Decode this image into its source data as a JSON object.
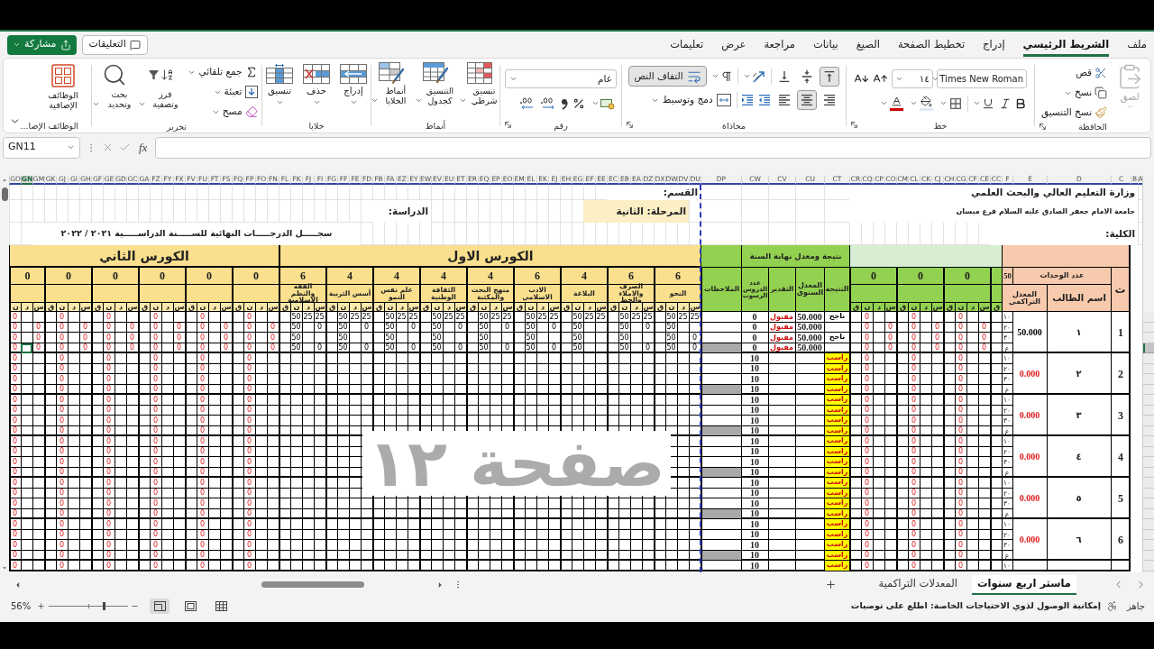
{
  "ribbon_tabs": [
    {
      "label": "ملف",
      "selected": false
    },
    {
      "label": "الشريط الرئيسي",
      "selected": true
    },
    {
      "label": "إدراج",
      "selected": false
    },
    {
      "label": "تخطيط الصفحة",
      "selected": false
    },
    {
      "label": "الصيغ",
      "selected": false
    },
    {
      "label": "بيانات",
      "selected": false
    },
    {
      "label": "مراجعة",
      "selected": false
    },
    {
      "label": "عرض",
      "selected": false
    },
    {
      "label": "تعليمات",
      "selected": false
    }
  ],
  "header_buttons": {
    "comments": "التعليقات",
    "share": "مشاركة"
  },
  "ribbon_groups": [
    {
      "kind": "clipboard",
      "label": "الحافظة",
      "paste": {
        "label": "لصق",
        "disabled": true
      },
      "cut": "قص",
      "copy": "نسخ",
      "format_painter": "نسخ التنسيق"
    },
    {
      "kind": "font",
      "label": "خط",
      "font_name": "Times New Roman",
      "font_size": "١٤"
    },
    {
      "kind": "alignment",
      "label": "محاذاة",
      "vertical": [
        {
          "selected": true
        },
        {
          "selected": false
        },
        {
          "selected": false
        }
      ],
      "wrap_text": {
        "label": "التفاف النص",
        "on": true
      },
      "horizontal": [
        {
          "selected": false
        },
        {
          "selected": true
        },
        {
          "selected": false
        }
      ],
      "merge": "دمج وتوسيط"
    },
    {
      "kind": "number",
      "label": "رقم",
      "format": "عام"
    },
    {
      "kind": "styles",
      "label": "أنماط",
      "buttons": [
        "تنسيق شرطي",
        "التنسيق كجدول",
        "أنماط الخلايا"
      ]
    },
    {
      "kind": "cells",
      "label": "خلايا",
      "buttons": [
        "إدراج",
        "حذف",
        "تنسيق"
      ]
    },
    {
      "kind": "editing",
      "label": "تحرير",
      "small_buttons": [
        "جمع تلقائي",
        "تعبئة",
        "مسح"
      ],
      "buttons": [
        "فرز وتصفية",
        "بحث وتحديد"
      ]
    },
    {
      "kind": "addins",
      "label": "الوظائف الإضا...",
      "button": "الوظائف الإضافية"
    }
  ],
  "formula_bar": {
    "name_box": "GN11",
    "function_button": "fx"
  },
  "sheet": {
    "columns": [
      {
        "label": "A",
        "selected": false
      },
      {
        "label": "B",
        "selected": false
      },
      {
        "label": "C",
        "selected": false
      },
      {
        "label": "D",
        "selected": false
      },
      {
        "label": "E",
        "selected": false
      },
      {
        "label": "F",
        "selected": false
      },
      {
        "label": "CC",
        "selected": false
      },
      {
        "label": "CE",
        "selected": false
      },
      {
        "label": "CF",
        "selected": false
      },
      {
        "label": "CG",
        "selected": false
      },
      {
        "label": "CH",
        "selected": false
      },
      {
        "label": "CJ",
        "selected": false
      },
      {
        "label": "CK",
        "selected": false
      },
      {
        "label": "CL",
        "selected": false
      },
      {
        "label": "CM",
        "selected": false
      },
      {
        "label": "CO",
        "selected": false
      },
      {
        "label": "CP",
        "selected": false
      },
      {
        "label": "CQ",
        "selected": false
      },
      {
        "label": "CR",
        "selected": false
      },
      {
        "label": "CT",
        "selected": false
      },
      {
        "label": "CU",
        "selected": false
      },
      {
        "label": "CV",
        "selected": false
      },
      {
        "label": "CW",
        "selected": false
      },
      {
        "label": "DP",
        "selected": false
      },
      {
        "label": "DU",
        "selected": false
      },
      {
        "label": "DV",
        "selected": false
      },
      {
        "label": "DW",
        "selected": false
      },
      {
        "label": "DX",
        "selected": false
      },
      {
        "label": "DZ",
        "selected": false
      },
      {
        "label": "EA",
        "selected": false
      },
      {
        "label": "EB",
        "selected": false
      },
      {
        "label": "EC",
        "selected": false
      },
      {
        "label": "EE",
        "selected": false
      },
      {
        "label": "EF",
        "selected": false
      },
      {
        "label": "EG",
        "selected": false
      },
      {
        "label": "EH",
        "selected": false
      },
      {
        "label": "EJ",
        "selected": false
      },
      {
        "label": "EK",
        "selected": false
      },
      {
        "label": "EL",
        "selected": false
      },
      {
        "label": "EM",
        "selected": false
      },
      {
        "label": "EO",
        "selected": false
      },
      {
        "label": "EP",
        "selected": false
      },
      {
        "label": "EQ",
        "selected": false
      },
      {
        "label": "ER",
        "selected": false
      },
      {
        "label": "ET",
        "selected": false
      },
      {
        "label": "EU",
        "selected": false
      },
      {
        "label": "EV",
        "selected": false
      },
      {
        "label": "EW",
        "selected": false
      },
      {
        "label": "EY",
        "selected": false
      },
      {
        "label": "EZ",
        "selected": false
      },
      {
        "label": "FA",
        "selected": false
      },
      {
        "label": "FB",
        "selected": false
      },
      {
        "label": "FD",
        "selected": false
      },
      {
        "label": "FE",
        "selected": false
      },
      {
        "label": "FF",
        "selected": false
      },
      {
        "label": "FG",
        "selected": false
      },
      {
        "label": "FI",
        "selected": false
      },
      {
        "label": "FJ",
        "selected": false
      },
      {
        "label": "FK",
        "selected": false
      },
      {
        "label": "FL",
        "selected": false
      },
      {
        "label": "FN",
        "selected": false
      },
      {
        "label": "FO",
        "selected": false
      },
      {
        "label": "FP",
        "selected": false
      },
      {
        "label": "FQ",
        "selected": false
      },
      {
        "label": "FS",
        "selected": false
      },
      {
        "label": "FT",
        "selected": false
      },
      {
        "label": "FU",
        "selected": false
      },
      {
        "label": "FV",
        "selected": false
      },
      {
        "label": "FX",
        "selected": false
      },
      {
        "label": "FY",
        "selected": false
      },
      {
        "label": "FZ",
        "selected": false
      },
      {
        "label": "GA",
        "selected": false
      },
      {
        "label": "GC",
        "selected": false
      },
      {
        "label": "GD",
        "selected": false
      },
      {
        "label": "GE",
        "selected": false
      },
      {
        "label": "GF",
        "selected": false
      },
      {
        "label": "GH",
        "selected": false
      },
      {
        "label": "GI",
        "selected": false
      },
      {
        "label": "GJ",
        "selected": false
      },
      {
        "label": "GK",
        "selected": false
      },
      {
        "label": "GM",
        "selected": false
      },
      {
        "label": "GN",
        "selected": true
      },
      {
        "label": "GO",
        "selected": false
      }
    ],
    "title_rows": {
      "ministry": "وزارة التعليم العالي والبحث العلمي",
      "department": "القسم:",
      "university": "جامعة الامام جعفر الصادق عليه السلام فرع ميسان",
      "stage": "المرحلة: الثانية",
      "study": "الدراسة:",
      "college": "الكلية:",
      "record_title": "سجـــــل الدرجـــــات النهائية للســـــنة الدراســـــية ٢٠٢١ / ٢٠٢٢"
    },
    "headers": {
      "number": "ت",
      "units_label": "عدد الوحدات",
      "units_total": "50",
      "student_name": "اسم الطالب",
      "cumulative": "المعدل التراكمي",
      "year_result_title": "نتيجة ومعدل نهاية السنة",
      "result": "النتيجة",
      "annual_average": "المعدل السنوي",
      "grade": "التقدير",
      "failed_subjects": "عدد الدروس الرسوب",
      "notes": "الملاحظات"
    },
    "extra_column": "ق",
    "extra_subjects": [
      {
        "units": "0",
        "columns": [
          "س",
          "د",
          "ن",
          "ق"
        ]
      },
      {
        "units": "0",
        "columns": [
          "س",
          "د",
          "ن",
          "ق"
        ]
      },
      {
        "units": "0",
        "columns": [
          "س",
          "د",
          "ن",
          "ق"
        ]
      }
    ],
    "first_course": {
      "title": "الكورس الاول",
      "subjects": [
        {
          "units": "6",
          "name": "النحو",
          "columns": [
            "س",
            "د",
            "ن",
            "ق"
          ]
        },
        {
          "units": "6",
          "name": "الصرف والاملاء والخط",
          "columns": [
            "س",
            "د",
            "ن",
            "ق"
          ]
        },
        {
          "units": "4",
          "name": "البلاغة",
          "columns": [
            "س",
            "د",
            "ن",
            "ق"
          ]
        },
        {
          "units": "6",
          "name": "الادب الاسلامي",
          "columns": [
            "س",
            "د",
            "ن",
            "ق"
          ]
        },
        {
          "units": "4",
          "name": "منهج البحث والمكتبة",
          "columns": [
            "س",
            "د",
            "ن",
            "ق"
          ]
        },
        {
          "units": "4",
          "name": "الثقافة الوطنية",
          "columns": [
            "س",
            "د",
            "ن",
            "ق"
          ]
        },
        {
          "units": "4",
          "name": "علم نفس النمو",
          "columns": [
            "س",
            "د",
            "ن",
            "ق"
          ]
        },
        {
          "units": "4",
          "name": "أسس التربية",
          "columns": [
            "س",
            "د",
            "ن",
            "ق"
          ]
        },
        {
          "units": "6",
          "name": "الفقه والنظم الاسلامية",
          "columns": [
            "س",
            "د",
            "ن",
            "ق"
          ]
        }
      ]
    },
    "second_course": {
      "title": "الكورس الثاني",
      "subjects": [
        {
          "units": "0",
          "columns": [
            "س",
            "د",
            "ن",
            "ق"
          ]
        },
        {
          "units": "0",
          "columns": [
            "س",
            "د",
            "ن",
            "ق"
          ]
        },
        {
          "units": "0",
          "columns": [
            "س",
            "د",
            "ن",
            "ق"
          ]
        },
        {
          "units": "0",
          "columns": [
            "س",
            "د",
            "ن",
            "ق"
          ]
        },
        {
          "units": "0",
          "columns": [
            "س",
            "د",
            "ن",
            "ق"
          ]
        },
        {
          "units": "0",
          "columns": [
            "س",
            "د",
            "ن"
          ]
        }
      ]
    },
    "students": [
      {
        "number": "1",
        "name": "١",
        "cumulative": "50.000",
        "failed": false,
        "rows": [
          {
            "label": "١٠",
            "extra": [
              {
                "column_3": "0"
              },
              {
                "column_3": "0"
              },
              {
                "column_3": "0"
              }
            ],
            "result": "ناجح",
            "annual": "50.000",
            "grade": "مقبول",
            "failed_subjects": "0",
            "first_course": [
              {
                "column_1": "25",
                "column_2": "25",
                "column_3": "50"
              },
              {
                "column_1": "25",
                "column_2": "25",
                "column_3": "50"
              },
              {
                "column_1": "25",
                "column_2": "25",
                "column_3": "50"
              },
              {
                "column_1": "25",
                "column_2": "25",
                "column_3": "50"
              },
              {
                "column_1": "25",
                "column_2": "25",
                "column_3": "50"
              },
              {
                "column_1": "25",
                "column_2": "25",
                "column_3": "50"
              },
              {
                "column_1": "25",
                "column_2": "25",
                "column_3": "50"
              },
              {
                "column_1": "25",
                "column_2": "25",
                "column_3": "50"
              },
              {
                "column_1": "25",
                "column_2": "25",
                "column_3": "50"
              }
            ],
            "second_course": [
              {
                "column_3": "0"
              },
              {
                "column_3": "0"
              },
              {
                "column_3": "0"
              },
              {
                "column_3": "0"
              },
              {
                "column_3": "0"
              },
              {
                "column_3": "0"
              }
            ],
            "selected": false
          },
          {
            "label": "٢٠",
            "extra": [
              {
                "column_1": "0",
                "column_3": "0"
              },
              {
                "column_1": "0",
                "column_3": "0"
              },
              {
                "column_1": "0",
                "column_3": "0"
              }
            ],
            "annual": "50.000",
            "grade": "مقبول",
            "failed_subjects": "0",
            "first_course": [
              {
                "column_3": "50"
              },
              {
                "column_1": "0",
                "column_3": "50"
              },
              {
                "column_3": "50"
              },
              {
                "column_1": "0",
                "column_3": "50"
              },
              {
                "column_1": "0",
                "column_3": "50"
              },
              {
                "column_1": "0",
                "column_3": "50"
              },
              {
                "column_1": "0",
                "column_3": "50"
              },
              {
                "column_1": "0",
                "column_3": "50"
              },
              {
                "column_1": "0",
                "column_3": "50"
              }
            ],
            "second_course": [
              {
                "column_1": "0",
                "column_3": "0"
              },
              {
                "column_1": "0",
                "column_3": "0"
              },
              {
                "column_1": "0",
                "column_3": "0"
              },
              {
                "column_1": "0",
                "column_3": "0"
              },
              {
                "column_1": "0",
                "column_3": "0"
              },
              {
                "column_1": "0",
                "column_3": "0"
              }
            ],
            "selected": false
          },
          {
            "label": "٣٠",
            "extra": [
              {
                "column_1": "0",
                "column_3": "0"
              },
              {
                "column_1": "0",
                "column_3": "0"
              },
              {
                "column_1": "0",
                "column_3": "0"
              }
            ],
            "result": "ناجح",
            "annual": "50.000",
            "grade": "مقبول",
            "failed_subjects": "0",
            "first_course": [
              {
                "column_1": "0",
                "column_3": "50"
              },
              {
                "column_3": "50"
              },
              {
                "column_3": "50"
              },
              {
                "column_3": "50"
              },
              {
                "column_3": "50"
              },
              {
                "column_3": "50"
              },
              {
                "column_3": "50"
              },
              {
                "column_3": "50"
              },
              {
                "column_3": "50"
              }
            ],
            "second_course": [
              {
                "column_1": "0",
                "column_3": "0"
              },
              {
                "column_1": "0",
                "column_3": "0"
              },
              {
                "column_1": "0",
                "column_3": "0"
              },
              {
                "column_1": "0",
                "column_3": "0"
              },
              {
                "column_1": "0",
                "column_3": "0"
              },
              {
                "column_1": "0",
                "column_3": "0"
              }
            ],
            "selected": false
          },
          {
            "label": "ع",
            "extra": [
              {
                "column_1": "0",
                "column_3": "0"
              },
              {
                "column_1": "0",
                "column_3": "0"
              },
              {
                "column_1": "0",
                "column_3": "0"
              }
            ],
            "annual": "50.000",
            "grade": "مقبول",
            "failed_subjects": "0",
            "shaded": true,
            "first_course": [
              {
                "column_1": "0",
                "column_3": "50"
              },
              {
                "column_1": "0",
                "column_3": "50"
              },
              {
                "column_3": "50"
              },
              {
                "column_1": "0",
                "column_3": "50"
              },
              {
                "column_1": "0",
                "column_3": "50"
              },
              {
                "column_1": "0",
                "column_3": "50"
              },
              {
                "column_1": "0",
                "column_3": "50"
              },
              {
                "column_1": "0",
                "column_3": "50"
              },
              {
                "column_1": "0",
                "column_3": "50"
              }
            ],
            "second_course": [
              {
                "column_1": "0",
                "column_3": "0"
              },
              {
                "column_1": "0",
                "column_3": "0"
              },
              {
                "column_1": "0",
                "column_3": "0"
              },
              {
                "column_1": "0",
                "column_3": "0"
              },
              {
                "column_1": "0",
                "column_3": "0"
              },
              {
                "column_1": "0",
                "column_3": "0"
              }
            ],
            "selected": true
          }
        ]
      },
      {
        "number": "2",
        "name": "٢",
        "cumulative": "0.000",
        "failed": true,
        "rows": [
          {
            "label": "١٠",
            "extra": [
              {
                "column_3": "0"
              },
              {
                "column_3": "0"
              },
              {
                "column_3": "0"
              }
            ],
            "result": "راسب",
            "failed_subjects": "10",
            "second_course": [
              {
                "column_3": "0"
              },
              {
                "column_3": "0"
              },
              {
                "column_3": "0"
              },
              {
                "column_3": "0"
              },
              {
                "column_3": "0"
              },
              {
                "column_3": "0"
              }
            ],
            "selected": false
          },
          {
            "label": "٢٠",
            "extra": [
              {
                "column_3": "0"
              },
              {
                "column_3": "0"
              },
              {
                "column_3": "0"
              }
            ],
            "result": "راسب",
            "failed_subjects": "10",
            "second_course": [
              {
                "column_3": "0"
              },
              {
                "column_3": "0"
              },
              {
                "column_3": "0"
              },
              {
                "column_3": "0"
              },
              {
                "column_3": "0"
              },
              {
                "column_3": "0"
              }
            ],
            "selected": false
          },
          {
            "label": "٣٠",
            "extra": [
              {
                "column_3": "0"
              },
              {
                "column_3": "0"
              },
              {
                "column_3": "0"
              }
            ],
            "result": "راسب",
            "failed_subjects": "10",
            "second_course": [
              {
                "column_3": "0"
              },
              {
                "column_3": "0"
              },
              {
                "column_3": "0"
              },
              {
                "column_3": "0"
              },
              {
                "column_3": "0"
              },
              {
                "column_3": "0"
              }
            ],
            "selected": false
          },
          {
            "label": "ع",
            "extra": [
              {
                "column_3": "0"
              },
              {
                "column_3": "0"
              },
              {
                "column_3": "0"
              }
            ],
            "result": "راسب",
            "failed_subjects": "10",
            "shaded": true,
            "second_course": [
              {
                "column_3": "0"
              },
              {
                "column_3": "0"
              },
              {
                "column_3": "0"
              },
              {
                "column_3": "0"
              },
              {
                "column_3": "0"
              },
              {
                "column_3": "0"
              }
            ],
            "selected": false
          }
        ]
      },
      {
        "number": "3",
        "name": "٣",
        "cumulative": "0.000",
        "failed": true,
        "rows": [
          {
            "label": "١٠",
            "extra": [
              {
                "column_3": "0"
              },
              {
                "column_3": "0"
              },
              {
                "column_3": "0"
              }
            ],
            "result": "راسب",
            "failed_subjects": "10",
            "second_course": [
              {
                "column_3": "0"
              },
              {
                "column_3": "0"
              },
              {
                "column_3": "0"
              },
              {
                "column_3": "0"
              },
              {
                "column_3": "0"
              },
              {
                "column_3": "0"
              }
            ],
            "selected": false
          },
          {
            "label": "٢٠",
            "extra": [
              {
                "column_3": "0"
              },
              {
                "column_3": "0"
              },
              {
                "column_3": "0"
              }
            ],
            "result": "راسب",
            "failed_subjects": "10",
            "second_course": [
              {
                "column_3": "0"
              },
              {
                "column_3": "0"
              },
              {
                "column_3": "0"
              },
              {
                "column_3": "0"
              },
              {
                "column_3": "0"
              },
              {
                "column_3": "0"
              }
            ],
            "selected": false
          },
          {
            "label": "٣٠",
            "extra": [
              {
                "column_3": "0"
              },
              {
                "column_3": "0"
              },
              {
                "column_3": "0"
              }
            ],
            "result": "راسب",
            "failed_subjects": "10",
            "second_course": [
              {
                "column_3": "0"
              },
              {
                "column_3": "0"
              },
              {
                "column_3": "0"
              },
              {
                "column_3": "0"
              },
              {
                "column_3": "0"
              },
              {
                "column_3": "0"
              }
            ],
            "selected": false
          },
          {
            "label": "ع",
            "extra": [
              {
                "column_3": "0"
              },
              {
                "column_3": "0"
              },
              {
                "column_3": "0"
              }
            ],
            "result": "راسب",
            "failed_subjects": "10",
            "shaded": true,
            "second_course": [
              {
                "column_3": "0"
              },
              {
                "column_3": "0"
              },
              {
                "column_3": "0"
              },
              {
                "column_3": "0"
              },
              {
                "column_3": "0"
              },
              {
                "column_3": "0"
              }
            ],
            "selected": false
          }
        ]
      },
      {
        "number": "4",
        "name": "٤",
        "cumulative": "0.000",
        "failed": true,
        "rows": [
          {
            "label": "١٠",
            "extra": [
              {
                "column_3": "0"
              },
              {
                "column_3": "0"
              },
              {
                "column_3": "0"
              }
            ],
            "result": "راسب",
            "failed_subjects": "10",
            "second_course": [
              {
                "column_3": "0"
              },
              {
                "column_3": "0"
              },
              {
                "column_3": "0"
              },
              {
                "column_3": "0"
              },
              {
                "column_3": "0"
              },
              {
                "column_3": "0"
              }
            ],
            "selected": false
          },
          {
            "label": "٢٠",
            "extra": [
              {
                "column_3": "0"
              },
              {
                "column_3": "0"
              },
              {
                "column_3": "0"
              }
            ],
            "result": "راسب",
            "failed_subjects": "10",
            "second_course": [
              {
                "column_3": "0"
              },
              {
                "column_3": "0"
              },
              {
                "column_3": "0"
              },
              {
                "column_3": "0"
              },
              {
                "column_3": "0"
              },
              {
                "column_3": "0"
              }
            ],
            "selected": false
          },
          {
            "label": "٣٠",
            "extra": [
              {
                "column_3": "0"
              },
              {
                "column_3": "0"
              },
              {
                "column_3": "0"
              }
            ],
            "result": "راسب",
            "failed_subjects": "10",
            "second_course": [
              {
                "column_3": "0"
              },
              {
                "column_3": "0"
              },
              {
                "column_3": "0"
              },
              {
                "column_3": "0"
              },
              {
                "column_3": "0"
              },
              {
                "column_3": "0"
              }
            ],
            "selected": false
          },
          {
            "label": "ع",
            "extra": [
              {
                "column_3": "0"
              },
              {
                "column_3": "0"
              },
              {
                "column_3": "0"
              }
            ],
            "result": "راسب",
            "failed_subjects": "10",
            "shaded": true,
            "second_course": [
              {
                "column_3": "0"
              },
              {
                "column_3": "0"
              },
              {
                "column_3": "0"
              },
              {
                "column_3": "0"
              },
              {
                "column_3": "0"
              },
              {
                "column_3": "0"
              }
            ],
            "selected": false
          }
        ]
      },
      {
        "number": "5",
        "name": "٥",
        "cumulative": "0.000",
        "failed": true,
        "rows": [
          {
            "label": "١٠",
            "extra": [
              {
                "column_3": "0"
              },
              {
                "column_3": "0"
              },
              {
                "column_3": "0"
              }
            ],
            "result": "راسب",
            "failed_subjects": "10",
            "second_course": [
              {
                "column_3": "0"
              },
              {
                "column_3": "0"
              },
              {
                "column_3": "0"
              },
              {
                "column_3": "0"
              },
              {
                "column_3": "0"
              },
              {
                "column_3": "0"
              }
            ],
            "selected": false
          },
          {
            "label": "٢٠",
            "extra": [
              {
                "column_3": "0"
              },
              {
                "column_3": "0"
              },
              {
                "column_3": "0"
              }
            ],
            "result": "راسب",
            "failed_subjects": "10",
            "second_course": [
              {
                "column_3": "0"
              },
              {
                "column_3": "0"
              },
              {
                "column_3": "0"
              },
              {
                "column_3": "0"
              },
              {
                "column_3": "0"
              },
              {
                "column_3": "0"
              }
            ],
            "selected": false
          },
          {
            "label": "٣٠",
            "extra": [
              {
                "column_3": "0"
              },
              {
                "column_3": "0"
              },
              {
                "column_3": "0"
              }
            ],
            "result": "راسب",
            "failed_subjects": "10",
            "second_course": [
              {
                "column_3": "0"
              },
              {
                "column_3": "0"
              },
              {
                "column_3": "0"
              },
              {
                "column_3": "0"
              },
              {
                "column_3": "0"
              },
              {
                "column_3": "0"
              }
            ],
            "selected": false
          },
          {
            "label": "ع",
            "extra": [
              {
                "column_3": "0"
              },
              {
                "column_3": "0"
              },
              {
                "column_3": "0"
              }
            ],
            "result": "راسب",
            "failed_subjects": "10",
            "shaded": true,
            "second_course": [
              {
                "column_3": "0"
              },
              {
                "column_3": "0"
              },
              {
                "column_3": "0"
              },
              {
                "column_3": "0"
              },
              {
                "column_3": "0"
              },
              {
                "column_3": "0"
              }
            ],
            "selected": false
          }
        ]
      },
      {
        "number": "6",
        "name": "٦",
        "cumulative": "0.000",
        "failed": true,
        "rows": [
          {
            "label": "١٠",
            "extra": [
              {
                "column_3": "0"
              },
              {
                "column_3": "0"
              },
              {
                "column_3": "0"
              }
            ],
            "result": "راسب",
            "failed_subjects": "10",
            "second_course": [
              {
                "column_3": "0"
              },
              {
                "column_3": "0"
              },
              {
                "column_3": "0"
              },
              {
                "column_3": "0"
              },
              {
                "column_3": "0"
              },
              {
                "column_3": "0"
              }
            ],
            "selected": false
          },
          {
            "label": "٢٠",
            "extra": [
              {
                "column_3": "0"
              },
              {
                "column_3": "0"
              },
              {
                "column_3": "0"
              }
            ],
            "result": "راسب",
            "failed_subjects": "10",
            "second_course": [
              {
                "column_3": "0"
              },
              {
                "column_3": "0"
              },
              {
                "column_3": "0"
              },
              {
                "column_3": "0"
              },
              {
                "column_3": "0"
              },
              {
                "column_3": "0"
              }
            ],
            "selected": false
          },
          {
            "label": "٣٠",
            "extra": [
              {
                "column_3": "0"
              },
              {
                "column_3": "0"
              },
              {
                "column_3": "0"
              }
            ],
            "result": "راسب",
            "failed_subjects": "10",
            "second_course": [
              {
                "column_3": "0"
              },
              {
                "column_3": "0"
              },
              {
                "column_3": "0"
              },
              {
                "column_3": "0"
              },
              {
                "column_3": "0"
              },
              {
                "column_3": "0"
              }
            ],
            "selected": false
          },
          {
            "label": "ع",
            "extra": [
              {
                "column_3": "0"
              },
              {
                "column_3": "0"
              },
              {
                "column_3": "0"
              }
            ],
            "result": "راسب",
            "failed_subjects": "10",
            "shaded": true,
            "second_course": [
              {
                "column_3": "0"
              },
              {
                "column_3": "0"
              },
              {
                "column_3": "0"
              },
              {
                "column_3": "0"
              },
              {
                "column_3": "0"
              },
              {
                "column_3": "0"
              }
            ],
            "selected": false
          }
        ]
      },
      {
        "failed": true,
        "rows": [
          {
            "label": "١٠",
            "extra": [
              {
                "column_3": "0"
              },
              {
                "column_3": "0"
              },
              {
                "column_3": "0"
              }
            ],
            "result": "راسب",
            "failed_subjects": "10",
            "second_course": [
              {
                "column_3": "0"
              },
              {
                "column_3": "0"
              },
              {
                "column_3": "0"
              },
              {
                "column_3": "0"
              },
              {
                "column_3": "0"
              },
              {
                "column_3": "0"
              }
            ],
            "selected": false
          }
        ]
      }
    ],
    "page_watermark": "صفحة ١٢"
  },
  "sheet_tabs": [
    {
      "label": "ماستر اربع سنوات",
      "selected": true
    },
    {
      "label": "المعدلات التراكمية",
      "selected": false
    }
  ],
  "status_bar": {
    "status": "جاهز",
    "accessibility": "إمكانية الوصول لذوي الاحتياجات الخاصة: اطلع على توصيات",
    "views": [
      {
        "selected": false
      },
      {
        "selected": false
      },
      {
        "selected": true
      }
    ],
    "zoom": {
      "level": 0.7,
      "reading": "56%"
    }
  }
}
